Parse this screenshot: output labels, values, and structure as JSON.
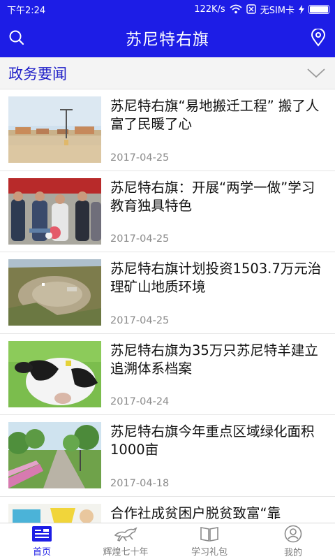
{
  "status_bar": {
    "time": "下午2:24",
    "net_speed": "122K/s",
    "sim_status": "无SIM卡"
  },
  "app_bar": {
    "title": "苏尼特右旗",
    "left_icon": "search-icon",
    "right_icon": "location-pin-icon",
    "color": "#1d1de6"
  },
  "section": {
    "title": "政务要闻",
    "toggle_icon": "chevron-down-icon",
    "title_color": "#1e1ec8"
  },
  "news": [
    {
      "title": "苏尼特右旗“易地搬迁工程” 搬了人富了民暖了心",
      "date": "2017-04-25",
      "image": "steppe-village-photo"
    },
    {
      "title": "苏尼特右旗：开展“两学一做”学习教育独具特色",
      "date": "2017-04-25",
      "image": "officials-meeting-photo"
    },
    {
      "title": "苏尼特右旗计划投资1503.7万元治理矿山地质环境",
      "date": "2017-04-25",
      "image": "mine-site-aerial-photo"
    },
    {
      "title": "苏尼特右旗为35万只苏尼特羊建立追溯体系档案",
      "date": "2017-04-24",
      "image": "calf-with-ear-tag-photo"
    },
    {
      "title": "苏尼特右旗今年重点区域绿化面积1000亩",
      "date": "2017-04-18",
      "image": "greenway-rendering-photo"
    },
    {
      "title": "合作社成贫困户脱贫致富“靠",
      "date": "",
      "image": "cartoon-illustration"
    }
  ],
  "bottom_nav": [
    {
      "label": "首页",
      "icon": "news-home-icon",
      "active": true
    },
    {
      "label": "辉煌七十年",
      "icon": "galloping-horse-icon",
      "active": false
    },
    {
      "label": "学习礼包",
      "icon": "open-book-icon",
      "active": false
    },
    {
      "label": "我的",
      "icon": "user-profile-icon",
      "active": false
    }
  ]
}
